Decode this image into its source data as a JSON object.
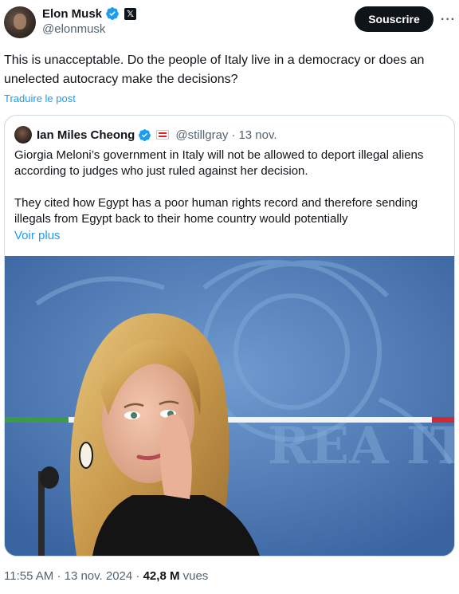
{
  "author": {
    "name": "Elon Musk",
    "handle": "@elonmusk",
    "verified_color": "#1d9bf0",
    "affiliate_badge": "𝕏"
  },
  "actions": {
    "subscribe_label": "Souscrire",
    "more_icon": "more-icon"
  },
  "tweet": {
    "text": "This is unacceptable. Do the people of Italy live in a democracy or does an unelected autocracy make the decisions?",
    "translate_label": "Traduire le post"
  },
  "quoted": {
    "name": "Ian Miles Cheong",
    "handle": "@stillgray",
    "separator": "·",
    "date": "13 nov.",
    "paragraph_1": "Giorgia Meloni’s government in Italy will not be allowed to deport illegal aliens according to judges who just ruled against her decision.",
    "paragraph_2": "They cited how Egypt has a poor human rights record and therefore sending illegals from Egypt back to their home country would potentially",
    "show_more_label": "Voir plus"
  },
  "footer": {
    "time": "11:55 AM",
    "separator": "·",
    "date": "13 nov. 2024",
    "views_count": "42,8 M",
    "views_label": "vues"
  },
  "colors": {
    "text": "#0f1419",
    "secondary": "#536471",
    "link": "#1d9bf0",
    "border": "#cfd9de"
  }
}
